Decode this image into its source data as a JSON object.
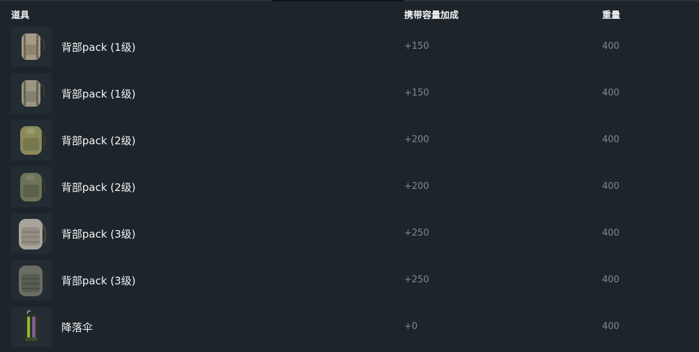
{
  "columns": {
    "item": "道具",
    "capacity": "携带容量加成",
    "weight": "重量"
  },
  "items": [
    {
      "name": "背部pack (1级)",
      "capacity": "+150",
      "weight": "400",
      "icon": "backpack-level1-icon",
      "color": "#a59a86"
    },
    {
      "name": "背部pack (1级)",
      "capacity": "+150",
      "weight": "400",
      "icon": "backpack-level1-icon",
      "color": "#9a9682"
    },
    {
      "name": "背部pack (2级)",
      "capacity": "+200",
      "weight": "400",
      "icon": "backpack-level2-icon",
      "color": "#8a8a5c"
    },
    {
      "name": "背部pack (2级)",
      "capacity": "+200",
      "weight": "400",
      "icon": "backpack-level2-icon",
      "color": "#6d7258"
    },
    {
      "name": "背部pack (3级)",
      "capacity": "+250",
      "weight": "400",
      "icon": "backpack-level3-icon",
      "color": "#a8a49a"
    },
    {
      "name": "背部pack (3级)",
      "capacity": "+250",
      "weight": "400",
      "icon": "backpack-level3-icon",
      "color": "#6a6e62"
    },
    {
      "name": "降落伞",
      "capacity": "+0",
      "weight": "400",
      "icon": "parachute-icon",
      "color": "#3a4a30"
    }
  ]
}
